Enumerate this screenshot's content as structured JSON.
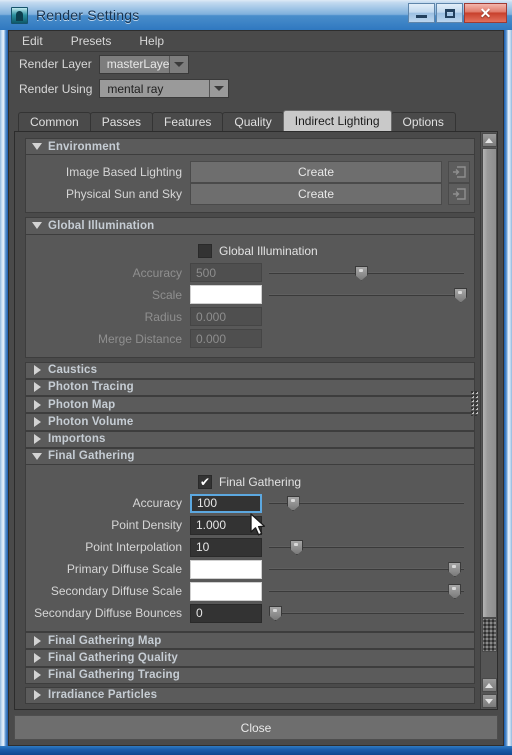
{
  "window": {
    "title": "Render Settings",
    "icon": "maya-app-icon",
    "buttons": {
      "minimize": "minimize-icon",
      "maximize": "maximize-icon",
      "close": "✕"
    }
  },
  "menubar": {
    "items": [
      "Edit",
      "Presets",
      "Help"
    ]
  },
  "render_layer": {
    "label": "Render Layer",
    "value": "masterLayer"
  },
  "render_using": {
    "label": "Render Using",
    "value": "mental ray"
  },
  "tabs": [
    {
      "label": "Common",
      "active": false
    },
    {
      "label": "Passes",
      "active": false
    },
    {
      "label": "Features",
      "active": false
    },
    {
      "label": "Quality",
      "active": false
    },
    {
      "label": "Indirect Lighting",
      "active": true
    },
    {
      "label": "Options",
      "active": false
    }
  ],
  "sections": {
    "environment": {
      "title": "Environment",
      "expanded": true,
      "rows": [
        {
          "label": "Image Based Lighting",
          "button": "Create",
          "map_icon": "map-input-icon"
        },
        {
          "label": "Physical Sun and Sky",
          "button": "Create",
          "map_icon": "map-input-icon"
        }
      ]
    },
    "global_illumination": {
      "title": "Global Illumination",
      "expanded": true,
      "checkbox": {
        "label": "Global Illumination",
        "checked": false
      },
      "accuracy": {
        "label": "Accuracy",
        "value": "500",
        "slider_pct": 44,
        "disabled": true
      },
      "scale": {
        "label": "Scale",
        "value": "",
        "slider_pct": 97,
        "swatch": true
      },
      "radius": {
        "label": "Radius",
        "value": "0.000",
        "disabled": true
      },
      "merge_distance": {
        "label": "Merge Distance",
        "value": "0.000",
        "disabled": true
      }
    },
    "caustics": {
      "title": "Caustics",
      "expanded": false
    },
    "photon_tracing": {
      "title": "Photon Tracing",
      "expanded": false
    },
    "photon_map": {
      "title": "Photon Map",
      "expanded": false
    },
    "photon_volume": {
      "title": "Photon Volume",
      "expanded": false
    },
    "importons": {
      "title": "Importons",
      "expanded": false
    },
    "final_gathering": {
      "title": "Final Gathering",
      "expanded": true,
      "checkbox": {
        "label": "Final Gathering",
        "checked": true,
        "mark": "✔"
      },
      "accuracy": {
        "label": "Accuracy",
        "value": "100",
        "slider_pct": 9,
        "focused": true
      },
      "point_density": {
        "label": "Point Density",
        "value": "1.000"
      },
      "point_interpolation": {
        "label": "Point Interpolation",
        "value": "10",
        "slider_pct": 12
      },
      "primary_diffuse_scale": {
        "label": "Primary Diffuse Scale",
        "value": "",
        "slider_pct": 94,
        "swatch": true
      },
      "secondary_diffuse_scale": {
        "label": "Secondary Diffuse Scale",
        "value": "",
        "slider_pct": 94,
        "swatch": true
      },
      "secondary_diffuse_bounces": {
        "label": "Secondary Diffuse Bounces",
        "value": "0",
        "slider_pct": 0
      }
    },
    "final_gathering_map": {
      "title": "Final Gathering Map",
      "expanded": false
    },
    "final_gathering_quality": {
      "title": "Final Gathering Quality",
      "expanded": false
    },
    "final_gathering_tracing": {
      "title": "Final Gathering Tracing",
      "expanded": false
    },
    "irradiance_particles": {
      "title": "Irradiance Particles",
      "expanded": false
    }
  },
  "footer": {
    "close_label": "Close"
  }
}
